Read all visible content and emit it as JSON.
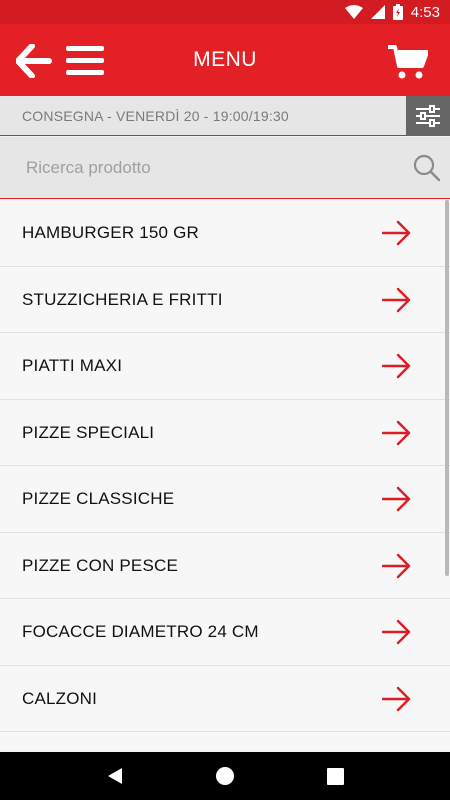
{
  "status_bar": {
    "time": "4:53",
    "icons": [
      "wifi-icon",
      "signal-icon",
      "battery-icon"
    ]
  },
  "header": {
    "title": "MENU",
    "back_icon": "arrow-left-icon",
    "menu_icon": "hamburger-icon",
    "cart_icon": "cart-icon"
  },
  "delivery": {
    "text": "CONSEGNA - VENERDÌ 20 - 19:00/19:30",
    "filter_icon": "sliders-icon"
  },
  "search": {
    "placeholder": "Ricerca prodotto",
    "value": "",
    "icon": "search-icon"
  },
  "categories": [
    {
      "label": "HAMBURGER 150 GR"
    },
    {
      "label": "STUZZICHERIA E FRITTI"
    },
    {
      "label": "PIATTI MAXI"
    },
    {
      "label": "PIZZE SPECIALI"
    },
    {
      "label": "PIZZE CLASSICHE"
    },
    {
      "label": "PIZZE CON PESCE"
    },
    {
      "label": "FOCACCE DIAMETRO 24 CM"
    },
    {
      "label": "CALZONI"
    },
    {
      "label": ""
    }
  ],
  "nav_bar": {
    "icons": [
      "back-triangle-icon",
      "home-circle-icon",
      "recents-square-icon"
    ]
  },
  "colors": {
    "brand_red": "#e42027",
    "status_red": "#d31c22",
    "arrow_red": "#d91e25",
    "filter_bg": "#666666"
  }
}
